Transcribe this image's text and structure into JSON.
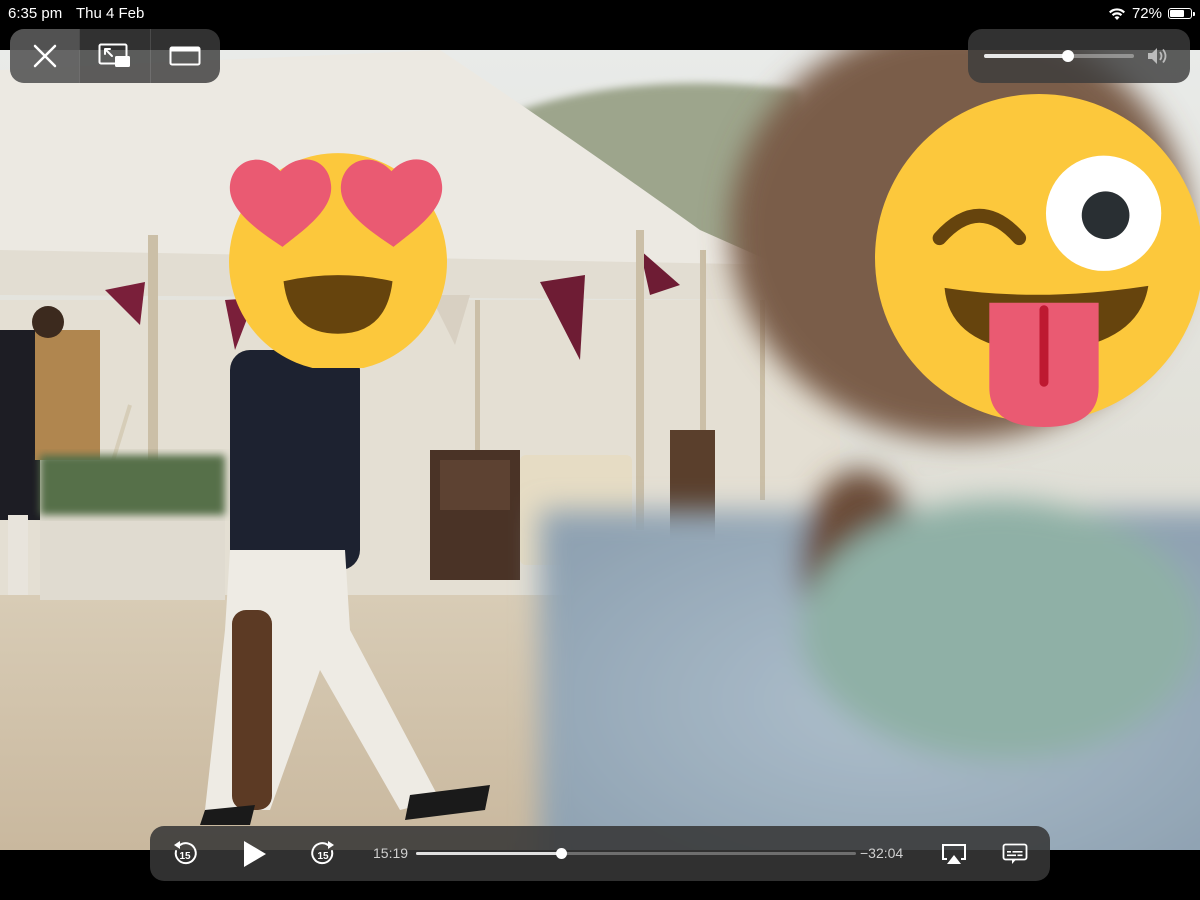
{
  "status_bar": {
    "time": "6:35 pm",
    "date": "Thu 4 Feb",
    "battery": "72%",
    "battery_level": 0.72,
    "icons": [
      "wifi-icon",
      "battery-icon"
    ]
  },
  "top_controls": {
    "icons": [
      "close-icon",
      "picture-in-picture-icon",
      "aspect-fill-icon"
    ]
  },
  "volume": {
    "level": 0.56,
    "icon": "speaker-icon"
  },
  "transport": {
    "elapsed": "15:19",
    "remaining": "−32:04",
    "progress": 0.33,
    "icons": [
      "skip-back-15-icon",
      "play-icon",
      "skip-forward-15-icon",
      "airplay-icon",
      "subtitles-icon"
    ],
    "skip_amount": "15"
  },
  "overlays": {
    "emojis": [
      "heart-eyes-emoji",
      "winking-tongue-emoji"
    ]
  },
  "colors": {
    "emoji_yellow": "#fcc83c",
    "heart_pink": "#ea5a72",
    "mouth_brown": "#66440d",
    "control_bg": "#3c3c3c"
  }
}
